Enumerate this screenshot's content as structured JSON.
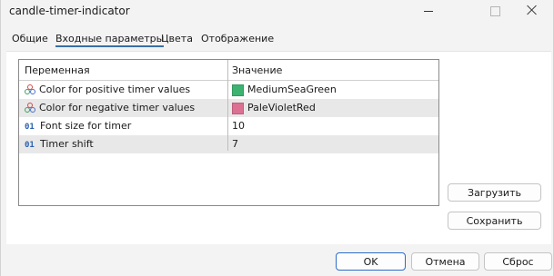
{
  "window": {
    "title": "candle-timer-indicator"
  },
  "tabs": [
    {
      "label": "Общие",
      "active": false
    },
    {
      "label": "Входные параметры",
      "active": true
    },
    {
      "label": "Цвета",
      "active": false
    },
    {
      "label": "Отображение",
      "active": false
    }
  ],
  "table": {
    "headers": {
      "variable": "Переменная",
      "value": "Значение"
    },
    "rows": [
      {
        "icon": "color-palette-icon",
        "name": "Color for positive timer values",
        "value": "MediumSeaGreen",
        "swatch": "#3cb371"
      },
      {
        "icon": "color-palette-icon",
        "name": "Color for negative timer values",
        "value": "PaleVioletRed",
        "swatch": "#db7093"
      },
      {
        "icon": "integer-type-icon",
        "icon_text": "01",
        "name": "Font size for timer",
        "value": "10"
      },
      {
        "icon": "integer-type-icon",
        "icon_text": "01",
        "name": "Timer shift",
        "value": "7"
      }
    ]
  },
  "side_buttons": {
    "load": "Загрузить",
    "save": "Сохранить"
  },
  "footer_buttons": {
    "ok": "OK",
    "cancel": "Отмена",
    "reset": "Сброс"
  },
  "colors": {
    "accent": "#2e6cc9",
    "selected_row": "#e8e8e8"
  }
}
